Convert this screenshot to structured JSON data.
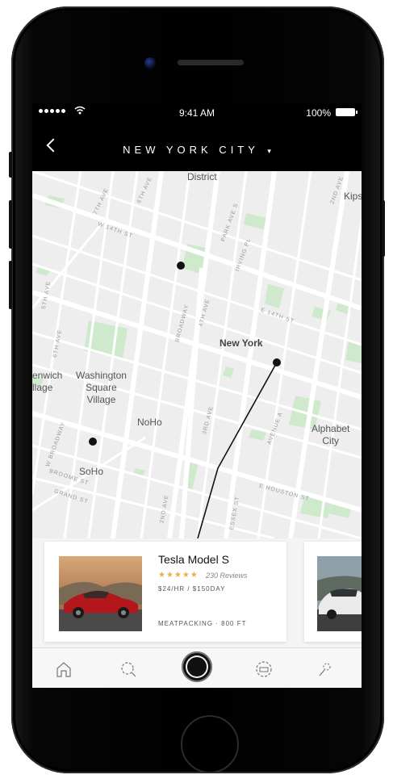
{
  "status_bar": {
    "time": "9:41 AM",
    "battery": "100%"
  },
  "header": {
    "city": "NEW YORK CITY",
    "caret": "▾"
  },
  "map": {
    "labels": {
      "district": "District",
      "kips": "Kips",
      "new_york": "New York",
      "greenwich": "enwich\nllage",
      "washington_square": "Washington\nSquare\nVillage",
      "noho": "NoHo",
      "alphabet_city": "Alphabet\nCity",
      "soho": "SoHo"
    },
    "streets": {
      "w14": "W 14TH ST",
      "e14": "E 14TH ST",
      "ave7": "7TH AVE",
      "ave6": "6TH AVE",
      "ave5": "5TH AVE",
      "ave4": "4TH AVE",
      "ave3": "3RD AVE",
      "ave2": "2ND AVE",
      "ave2top": "2ND AVE",
      "ave_a": "AVENUE A",
      "parkave": "PARK AVE S",
      "irving": "IRVING PL",
      "broadway": "BROADWAY",
      "wbroadway": "W BROADWAY",
      "broome": "BROOME ST",
      "grand": "GRAND ST",
      "houston": "E HOUSTON ST",
      "essex": "ESSEX ST",
      "sixth": "6TH AVE",
      "ave2b": "2ND AVE"
    }
  },
  "cards": [
    {
      "name": "Tesla Model S",
      "rating_stars": "★★★★★",
      "reviews": "230 Reviews",
      "price": "$24/HR / $150DAY",
      "location": "MEATPACKING · 800 FT"
    }
  ],
  "tabs": [
    "home-icon",
    "search-icon",
    "camera-button",
    "car-icon",
    "profile-icon"
  ],
  "colors": {
    "accent_star": "#e8b04b",
    "park": "#cfe9cc",
    "road": "#ffffff"
  }
}
